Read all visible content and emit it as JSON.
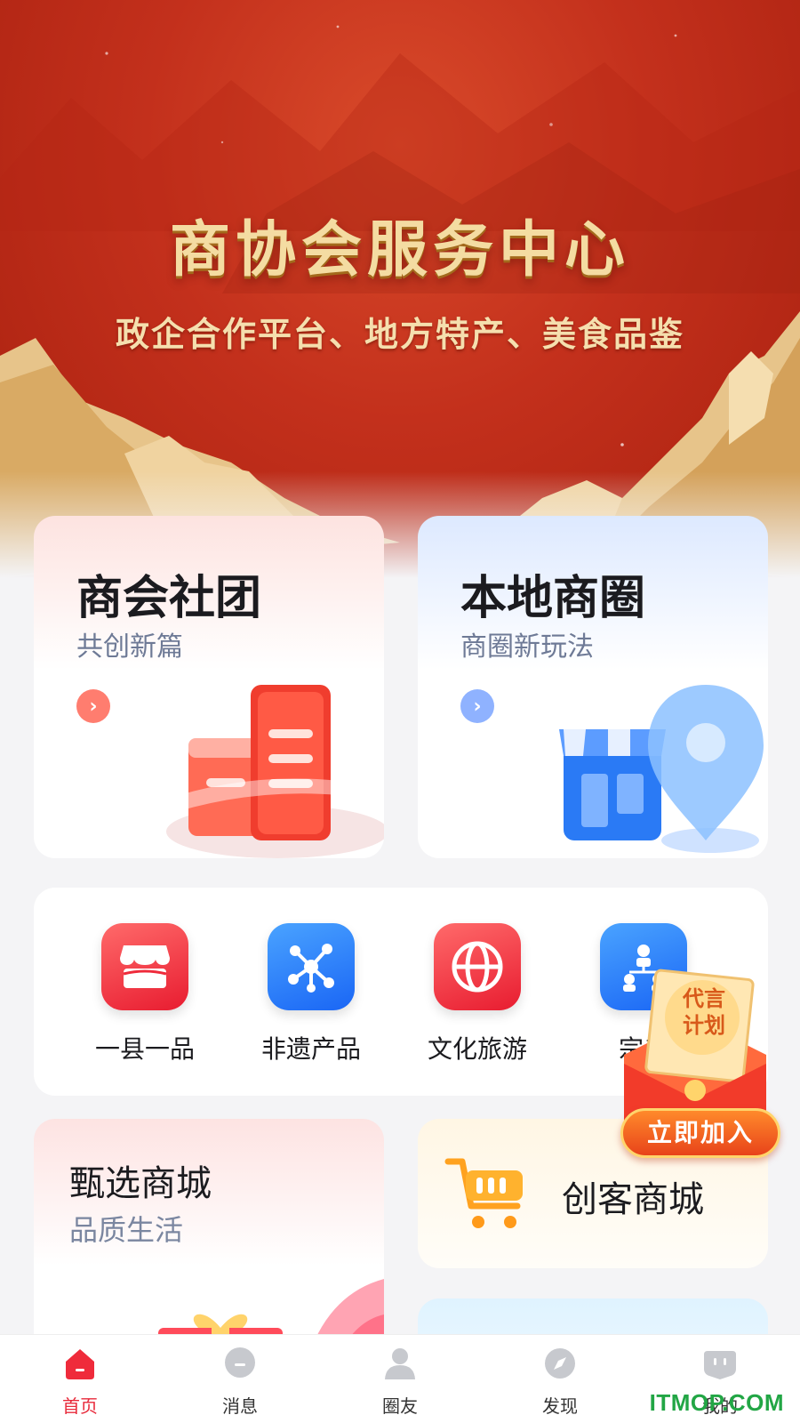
{
  "banner": {
    "title": "商协会服务中心",
    "subtitle": "政企合作平台、地方特产、美食品鉴"
  },
  "feature_cards": [
    {
      "title": "商会社团",
      "subtitle": "共创新篇",
      "icon": "office-building-icon",
      "accent": "#ff7d6f"
    },
    {
      "title": "本地商圈",
      "subtitle": "商圈新玩法",
      "icon": "store-location-pin-icon",
      "accent": "#8fb2ff"
    }
  ],
  "categories": [
    {
      "label": "一县一品",
      "icon": "storefront-icon",
      "color": "#ef2b3b"
    },
    {
      "label": "非遗产品",
      "icon": "network-nodes-icon",
      "color": "#1f6ff7"
    },
    {
      "label": "文化旅游",
      "icon": "globe-icon",
      "color": "#ef2b3b"
    },
    {
      "label": "宗亲",
      "icon": "org-chart-icon",
      "color": "#1f6ff7"
    }
  ],
  "mall_card": {
    "title": "甄选商城",
    "subtitle": "品质生活",
    "icon": "gift-box-icon"
  },
  "maker_card": {
    "title": "创客商城",
    "icon": "shopping-cart-icon"
  },
  "promo": {
    "tag": "代言\n计划",
    "button": "立即加入"
  },
  "tabbar": [
    {
      "label": "首页",
      "icon": "home-icon",
      "active": true
    },
    {
      "label": "消息",
      "icon": "message-bubble-icon",
      "active": false
    },
    {
      "label": "圈友",
      "icon": "person-icon",
      "active": false
    },
    {
      "label": "发现",
      "icon": "compass-icon",
      "active": false
    },
    {
      "label": "我的",
      "icon": "face-icon",
      "active": false
    }
  ],
  "watermark": "ITMOP.COM",
  "colors": {
    "brand_red": "#e8293a",
    "brand_blue": "#1f6ff7",
    "background": "#f4f4f6"
  }
}
